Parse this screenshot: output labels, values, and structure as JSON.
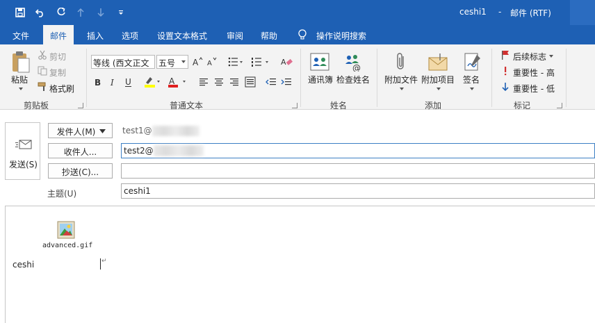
{
  "window": {
    "title": "ceshi1",
    "separator": "-",
    "mode": "邮件 (RTF)"
  },
  "quick_access": {
    "icons": [
      "save-icon",
      "undo-icon",
      "redo-icon",
      "up-arrow-icon",
      "down-arrow-icon",
      "customize-icon"
    ]
  },
  "tabs": [
    "文件",
    "邮件",
    "插入",
    "选项",
    "设置文本格式",
    "审阅",
    "帮助",
    "操作说明搜索"
  ],
  "ribbon": {
    "clipboard": {
      "paste": "粘贴",
      "cut": "剪切",
      "copy": "复制",
      "format_painter": "格式刷",
      "group_label": "剪贴板"
    },
    "basic_text": {
      "font": "等线 (西文正文",
      "size": "五号",
      "group_label": "普通文本"
    },
    "names": {
      "address_book": "通讯簿",
      "check_names": "检查姓名",
      "group_label": "姓名"
    },
    "include": {
      "attach_file": "附加文件",
      "attach_item": "附加项目",
      "signature": "签名",
      "group_label": "添加"
    },
    "tags": {
      "follow_up": "后续标志",
      "high_importance": "重要性 - 高",
      "low_importance": "重要性 - 低",
      "group_label": "标记"
    }
  },
  "compose": {
    "send_label": "发送(S)",
    "from_button": "发件人(M)",
    "from_value": "test1@",
    "to_button": "收件人...",
    "to_value": "test2@",
    "cc_button": "抄送(C)...",
    "cc_value": "",
    "subject_label": "主题(U)",
    "subject_value": "ceshi1"
  },
  "body": {
    "attachment_name": "advanced.gif",
    "text": "ceshi"
  },
  "colors": {
    "title_bar": "#1e60b4",
    "ribbon_bg": "#f3f3f3",
    "focus_border": "#3c7fc4",
    "highlight_yellow": "#ffff00",
    "font_red": "#e02020"
  }
}
